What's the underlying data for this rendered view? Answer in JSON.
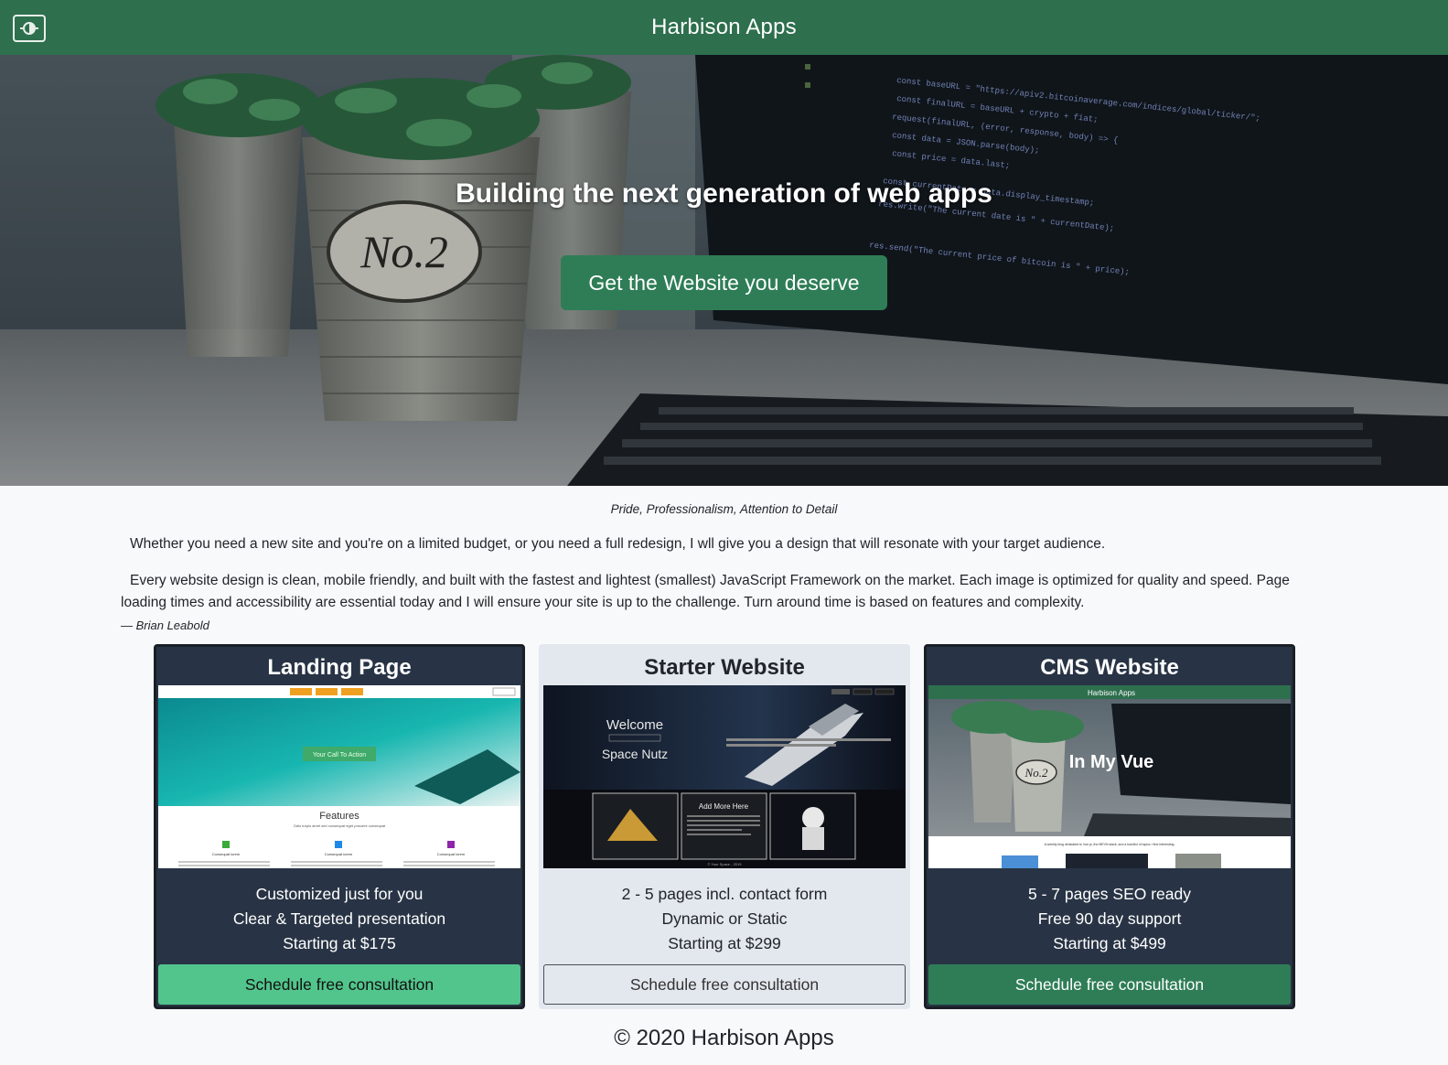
{
  "navbar": {
    "brand": "Harbison Apps",
    "toggle_icon": "brightness-toggle-icon"
  },
  "hero": {
    "title": "Building the next generation of web apps",
    "cta_label": "Get the Website you deserve",
    "pot_label": "No.2"
  },
  "intro": {
    "tagline": "Pride, Professionalism, Attention to Detail",
    "paragraph1": "Whether you need a new site and you're on a limited budget, or you need a full redesign, I wll give you a design that will resonate with your target audience.",
    "paragraph2": "Every website design is clean, mobile friendly, and built with the fastest and lightest (smallest) JavaScript Framework on the market. Each image is optimized for quality and speed. Page loading times and accessibility are essential today and I will ensure your site is up to the challenge. Turn around time is based on features and complexity.",
    "author": "— Brian Leabold"
  },
  "cards": [
    {
      "title": "Landing Page",
      "lines": [
        "Customized just for you",
        "Clear & Targeted presentation",
        "Starting at $175"
      ],
      "button": "Schedule free consultation",
      "preview": {
        "cta": "Your Call To Action",
        "heading": "Features",
        "subheading": "Odio turpis amet sed consequat eget posuere consequat",
        "items": [
          "Consequat lorem",
          "Consequat lorem",
          "Consequat lorem"
        ]
      }
    },
    {
      "title": "Starter Website",
      "lines": [
        "2 - 5 pages incl. contact form",
        "Dynamic or Static",
        "Starting at $299"
      ],
      "button": "Schedule free consultation",
      "preview": {
        "welcome": "Welcome",
        "subtitle": "Space Nutz",
        "tile": "Add More Here",
        "footer": "© Your Space - 2019"
      }
    },
    {
      "title": "CMS Website",
      "lines": [
        "5 - 7 pages SEO ready",
        "Free 90 day support",
        "Starting at $499"
      ],
      "button": "Schedule free consultation",
      "preview": {
        "brand": "Harbison Apps",
        "headline": "In My Vue",
        "pot_label": "No.2",
        "caption": "A weekly blog dedicated to Vue.js, the MEVN stack, and a handful of topics I find interesting."
      }
    }
  ],
  "footer": {
    "text": "© 2020 Harbison Apps"
  },
  "colors": {
    "navbar": "#2e6f4e",
    "cta": "#2e7d56",
    "card_dark": "#283445",
    "card_light": "#e3e7ee",
    "button_light_green": "#52c58c"
  }
}
